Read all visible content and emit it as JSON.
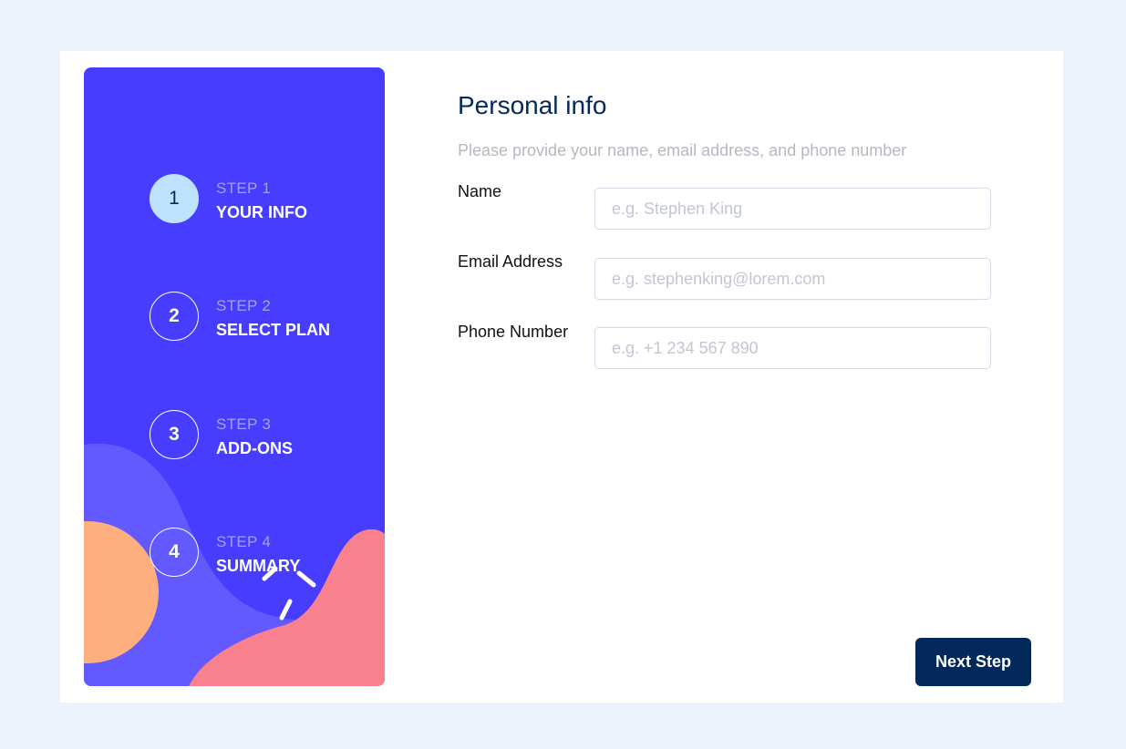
{
  "sidebar": {
    "steps": [
      {
        "number": "1",
        "label": "STEP 1",
        "title": "YOUR INFO",
        "active": true
      },
      {
        "number": "2",
        "label": "STEP 2",
        "title": "SELECT PLAN",
        "active": false
      },
      {
        "number": "3",
        "label": "STEP 3",
        "title": "ADD-ONS",
        "active": false
      },
      {
        "number": "4",
        "label": "STEP 4",
        "title": "SUMMARY",
        "active": false
      }
    ]
  },
  "form": {
    "title": "Personal info",
    "subtitle": "Please provide your name, email address, and phone number",
    "fields": [
      {
        "label": "Name",
        "placeholder": "e.g. Stephen King",
        "value": ""
      },
      {
        "label": "Email Address",
        "placeholder": "e.g. stephenking@lorem.com",
        "value": ""
      },
      {
        "label": "Phone Number",
        "placeholder": "e.g. +1 234 567 890",
        "value": ""
      }
    ],
    "next_label": "Next Step"
  },
  "colors": {
    "page_background": "#ebf2fb",
    "sidebar": "#473dff",
    "active_step": "#bee2fd",
    "primary_text": "#02295a",
    "button": "#022959",
    "blob_purple": "#6259ff",
    "blob_orange": "#ffaf7e",
    "blob_pink": "#f9818e"
  },
  "icons": {
    "sidebar_decoration": "abstract-shapes-illustration"
  }
}
